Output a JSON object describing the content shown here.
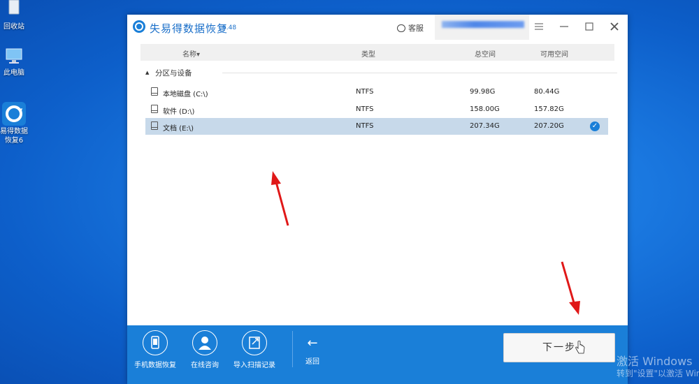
{
  "desktop": {
    "icons": [
      {
        "label": "回收站"
      },
      {
        "label": "此电脑"
      },
      {
        "label_line1": "易得数据",
        "label_line2": "恢复6"
      }
    ]
  },
  "app": {
    "title": "失易得数据恢复",
    "version": "6.48",
    "support_label": "客服",
    "accent_color": "#1a7fd8"
  },
  "table": {
    "columns": {
      "name": "名称",
      "type": "类型",
      "total": "总空间",
      "free": "可用空间"
    },
    "group_label": "分区与设备",
    "rows": [
      {
        "name": "本地磁盘 (C:\\)",
        "type": "NTFS",
        "total": "99.98G",
        "free": "80.44G",
        "selected": false
      },
      {
        "name": "软件 (D:\\)",
        "type": "NTFS",
        "total": "158.00G",
        "free": "157.82G",
        "selected": false
      },
      {
        "name": "文档 (E:\\)",
        "type": "NTFS",
        "total": "207.34G",
        "free": "207.20G",
        "selected": true
      }
    ]
  },
  "toolbar": {
    "phone_recovery": "手机数据恢复",
    "online_consult": "在线咨询",
    "import_scan": "导入扫描记录",
    "back": "返回",
    "next": "下一步"
  },
  "watermark": {
    "line1": "激活 Windows",
    "line2": "转到\"设置\"以激活 Windows。"
  }
}
